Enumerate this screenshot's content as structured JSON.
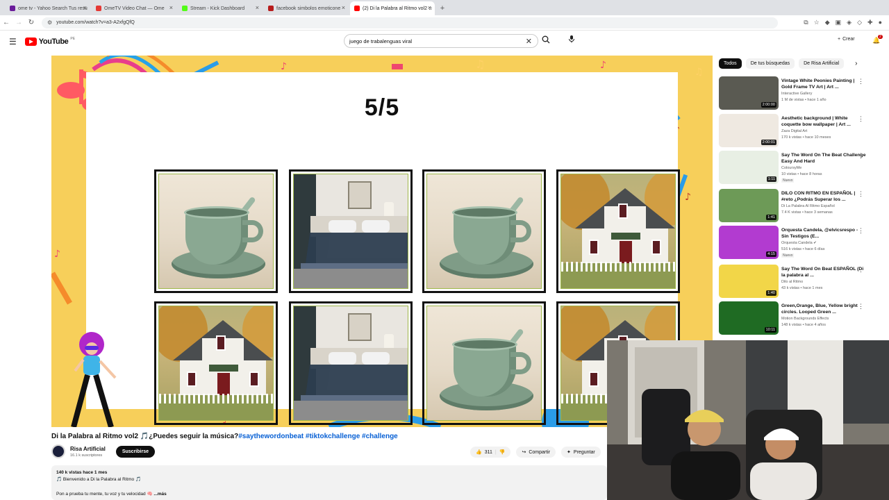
{
  "browser": {
    "tabs": [
      {
        "label": "ome tv - Yahoo Search Tus resu",
        "active": false,
        "color": "#6a1b9a"
      },
      {
        "label": "OmeTV Video Chat — Ome",
        "active": false,
        "color": "#e53935"
      },
      {
        "label": "Stream - Kick Dashboard",
        "active": false,
        "color": "#53fc18"
      },
      {
        "label": "facebook simbolos emoticone",
        "active": false,
        "color": "#b71c1c"
      },
      {
        "label": "(2) Di la Palabra al Ritmo vol2 ♫",
        "active": true,
        "color": "#ff0000"
      }
    ],
    "url": "youtube.com/watch?v=a3-A2xfgQfQ"
  },
  "youtube": {
    "logo_text": "YouTube",
    "country": "PE",
    "search_value": "juego de trabalenguas viral",
    "create_label": "Crear",
    "notif_count": "2"
  },
  "video": {
    "counter": "5/5",
    "grid": [
      "cup",
      "bed",
      "cup",
      "house",
      "house",
      "bed",
      "cup",
      "house"
    ],
    "title": "Di la Palabra al Ritmo vol2 🎵¿Puedes seguir la música?",
    "hashtags": "#saythewordonbeat #tiktokchallenge #challenge",
    "channel": "Risa Artificial",
    "subscribers": "16.1 k suscriptores",
    "subscribe_label": "Suscribirse",
    "likes": "311",
    "share_label": "Compartir",
    "ask_label": "Preguntar",
    "views_date": "140 k vistas  hace 1 mes",
    "desc_line1": "🎵 Bienvenido a Di la Palabra al Ritmo 🎵",
    "desc_line2": "Pon a prueba tu mente, tu voz y tu velocidad 🧠",
    "more_label": "...más"
  },
  "sidebar": {
    "chips": [
      "Todos",
      "De tus búsquedas",
      "De Risa Artificial"
    ],
    "items": [
      {
        "title": "Vintage White Peonies Painting | Gold Frame TV Art | Art ...",
        "channel": "Interactive Gallery",
        "meta": "1 M de vistas  • hace 1 año",
        "duration": "2:00:00",
        "badge": "",
        "thumb": "#5a5a52"
      },
      {
        "title": "Aesthetic background | White coquette bow wallpaper | Art ...",
        "channel": "Zaza Digital Art",
        "meta": "170 k vistas • hace 10 meses",
        "duration": "2:00:01",
        "badge": "",
        "thumb": "#efe9e1"
      },
      {
        "title": "Say The Word On The Beat Challenge Easy And Hard",
        "channel": "ColoursyMe",
        "meta": "10 vistas • hace 8 horas",
        "duration": "1:11",
        "badge": "Nuevo",
        "thumb": "#e8efe4"
      },
      {
        "title": "DILO CON RITMO EN ESPAÑOL | #reto ¿Podrás Superar los ...",
        "channel": "Di La Palabra Al Ritmo Español",
        "meta": "7.4 K vistas • hace 3 semanas",
        "duration": "1:41",
        "badge": "",
        "thumb": "#6d9a57"
      },
      {
        "title": "Orquesta Candela, @elvicsrespo - Sin Testigos (E...",
        "channel": "Orquesta Candela ✔",
        "meta": "516 k vistas • hace 6 días",
        "duration": "4:15",
        "badge": "Nuevo",
        "thumb": "#b23bd0"
      },
      {
        "title": "Say The Word On Beat ESPAÑOL (Di la palabra al ...",
        "channel": "Dilo al Ritmo",
        "meta": "43 k vistas • hace 1 mes",
        "duration": "1:40",
        "badge": "",
        "thumb": "#f2d648"
      },
      {
        "title": "Green,Orange, Blue, Yellow bright circles. Looped Green ...",
        "channel": "Motion Backgrounds Effects",
        "meta": "148 k vistas • hace 4 años",
        "duration": "10:11",
        "badge": "",
        "thumb": "#1f6b23"
      }
    ]
  }
}
